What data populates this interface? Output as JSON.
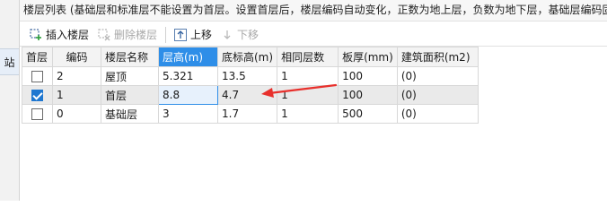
{
  "left_tab": {
    "label": "站"
  },
  "title_bar": {
    "text": "楼层列表 (基础层和标准层不能设置为首层。设置首层后，楼层编码自动变化，正数为地上层，负数为地下层，基础层编码固"
  },
  "toolbar": {
    "insert_label": "插入楼层",
    "delete_label": "删除楼层",
    "up_label": "上移",
    "down_label": "下移"
  },
  "table": {
    "columns": [
      "首层",
      "编码",
      "楼层名称",
      "层高(m)",
      "底标高(m)",
      "相同层数",
      "板厚(mm)",
      "建筑面积(m2)"
    ],
    "rows": [
      {
        "first": false,
        "code": "2",
        "name": "屋顶",
        "height": "5.321",
        "bottom": "13.5",
        "same": "1",
        "thickness": "100",
        "area": "(0)"
      },
      {
        "first": true,
        "code": "1",
        "name": "首层",
        "height": "8.8",
        "bottom": "4.7",
        "same": "1",
        "thickness": "100",
        "area": "(0)"
      },
      {
        "first": false,
        "code": "0",
        "name": "基础层",
        "height": "3",
        "bottom": "1.7",
        "same": "1",
        "thickness": "500",
        "area": "(0)"
      }
    ]
  },
  "colors": {
    "accent": "#2e8ee8",
    "annotation_arrow": "#e8302c"
  }
}
